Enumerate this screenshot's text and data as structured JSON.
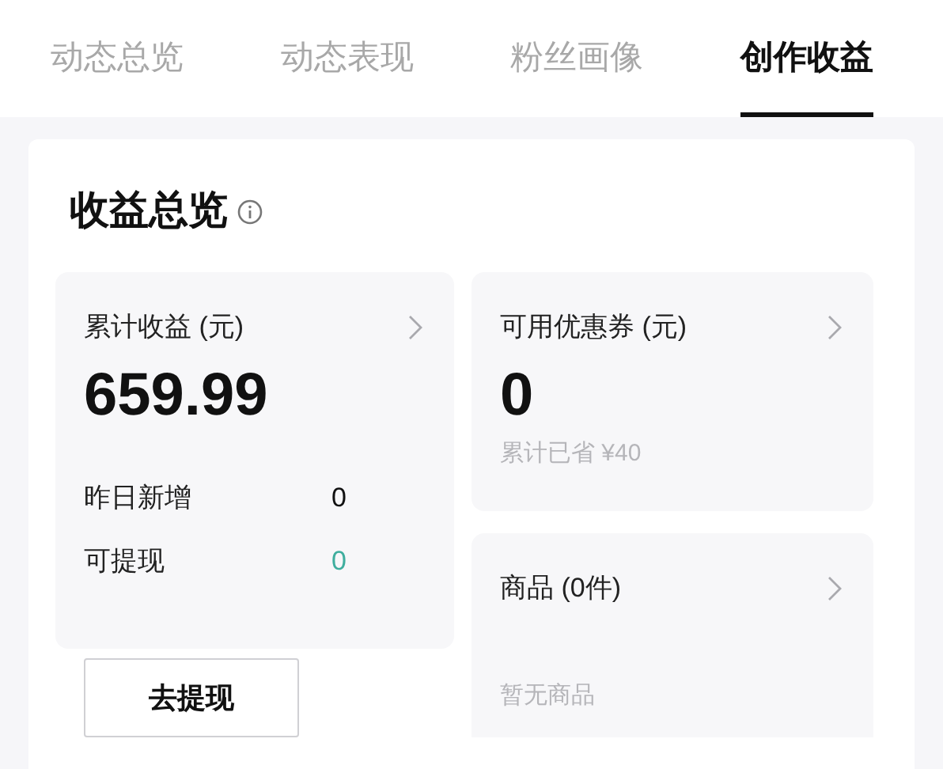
{
  "tabs": [
    {
      "label": "动态总览",
      "selected": false
    },
    {
      "label": "动态表现",
      "selected": false
    },
    {
      "label": "粉丝画像",
      "selected": false
    },
    {
      "label": "创作收益",
      "selected": true
    }
  ],
  "overview": {
    "title": "收益总览"
  },
  "earnings": {
    "label": "累计收益 (元)",
    "amount": "659.99",
    "stats": [
      {
        "label": "昨日新增",
        "value": "0",
        "color": "#111111"
      },
      {
        "label": "可提现",
        "value": "0",
        "color": "#3fae9e"
      }
    ],
    "button": "去提现"
  },
  "coupons": {
    "label": "可用优惠券 (元)",
    "amount": "0",
    "note": "累计已省 ¥40"
  },
  "products": {
    "label": "商品 (0件)",
    "empty_text": "暂无商品"
  }
}
